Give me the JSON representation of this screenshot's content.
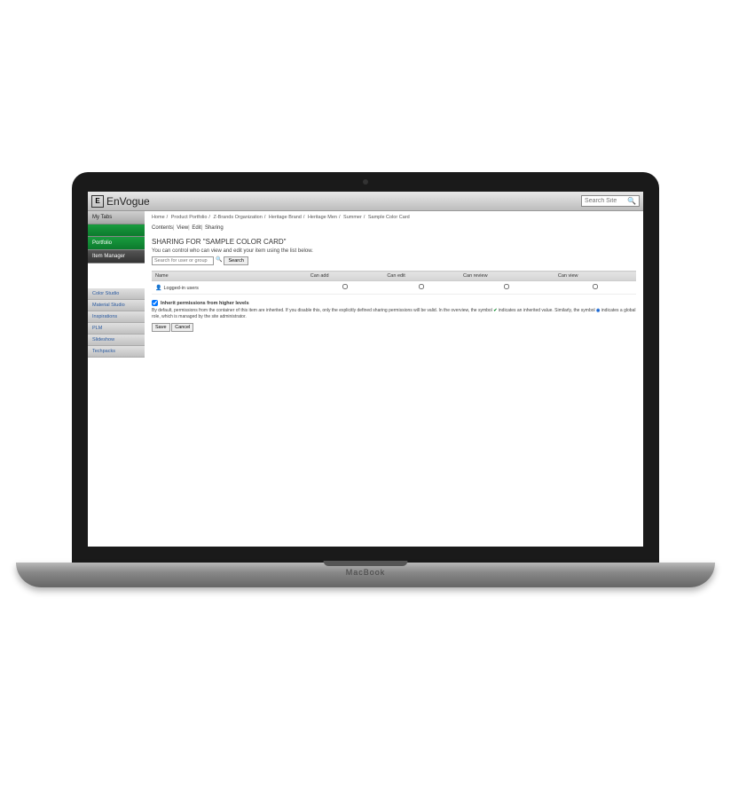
{
  "header": {
    "app_name": "EnVogue",
    "search_placeholder": "Search Site"
  },
  "sidebar": {
    "primary": [
      {
        "label": "My Tabs",
        "style": "gray"
      },
      {
        "label": "",
        "style": "green-spacer"
      },
      {
        "label": "Portfolio",
        "style": "green"
      },
      {
        "label": "Item Manager",
        "style": "dark"
      }
    ],
    "secondary": [
      {
        "label": "Color Studio"
      },
      {
        "label": "Material Studio"
      },
      {
        "label": "Inspirations"
      },
      {
        "label": "PLM"
      },
      {
        "label": "Slideshow"
      },
      {
        "label": "Techpacks"
      }
    ]
  },
  "breadcrumb": [
    "Home",
    "Product Portfolio",
    "Z-Brands Organization",
    "Heritage Brand",
    "Heritage Men",
    "Summer",
    "Sample Color Card"
  ],
  "tabs": [
    "Contents",
    "View",
    "Edit",
    "Sharing"
  ],
  "page": {
    "title": "SHARING FOR \"SAMPLE COLOR CARD\"",
    "subtitle": "You can control who can view and edit your item using the list below.",
    "search_placeholder": "Search for user or group",
    "search_button": "Search"
  },
  "table": {
    "columns": [
      "Name",
      "Can add",
      "Can edit",
      "Can review",
      "Can view"
    ],
    "rows": [
      {
        "name": "Logged-in users",
        "can_add": false,
        "can_edit": false,
        "can_review": false,
        "can_view": false
      }
    ]
  },
  "inherit": {
    "checked": true,
    "label": "Inherit permissions from higher levels",
    "description_pre": "By default, permissions from the container of this item are inherited. If you disable this, only the explicitly defined sharing permissions will be valid. In the overview, the symbol ",
    "description_mid1": " indicates an inherited value. Similarly, the symbol ",
    "description_mid2": " indicates a global role, which is managed by the site administrator."
  },
  "buttons": {
    "save": "Save",
    "cancel": "Cancel"
  },
  "laptop_label": "MacBook"
}
